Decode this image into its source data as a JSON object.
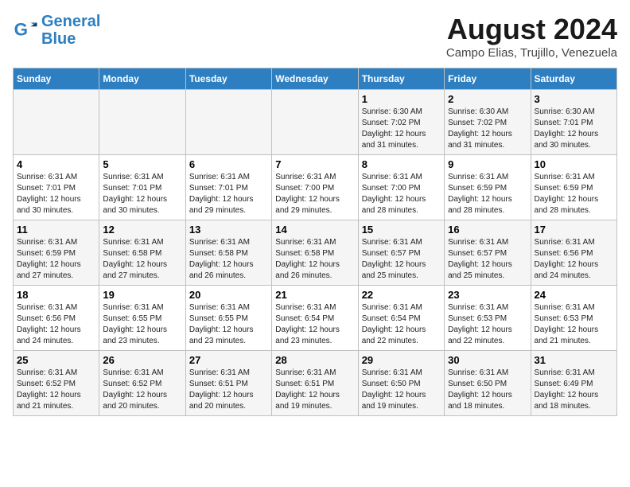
{
  "logo": {
    "line1": "General",
    "line2": "Blue"
  },
  "title": "August 2024",
  "subtitle": "Campo Elias, Trujillo, Venezuela",
  "days_of_week": [
    "Sunday",
    "Monday",
    "Tuesday",
    "Wednesday",
    "Thursday",
    "Friday",
    "Saturday"
  ],
  "weeks": [
    [
      {
        "day": "",
        "info": ""
      },
      {
        "day": "",
        "info": ""
      },
      {
        "day": "",
        "info": ""
      },
      {
        "day": "",
        "info": ""
      },
      {
        "day": "1",
        "info": "Sunrise: 6:30 AM\nSunset: 7:02 PM\nDaylight: 12 hours\nand 31 minutes."
      },
      {
        "day": "2",
        "info": "Sunrise: 6:30 AM\nSunset: 7:02 PM\nDaylight: 12 hours\nand 31 minutes."
      },
      {
        "day": "3",
        "info": "Sunrise: 6:30 AM\nSunset: 7:01 PM\nDaylight: 12 hours\nand 30 minutes."
      }
    ],
    [
      {
        "day": "4",
        "info": "Sunrise: 6:31 AM\nSunset: 7:01 PM\nDaylight: 12 hours\nand 30 minutes."
      },
      {
        "day": "5",
        "info": "Sunrise: 6:31 AM\nSunset: 7:01 PM\nDaylight: 12 hours\nand 30 minutes."
      },
      {
        "day": "6",
        "info": "Sunrise: 6:31 AM\nSunset: 7:01 PM\nDaylight: 12 hours\nand 29 minutes."
      },
      {
        "day": "7",
        "info": "Sunrise: 6:31 AM\nSunset: 7:00 PM\nDaylight: 12 hours\nand 29 minutes."
      },
      {
        "day": "8",
        "info": "Sunrise: 6:31 AM\nSunset: 7:00 PM\nDaylight: 12 hours\nand 28 minutes."
      },
      {
        "day": "9",
        "info": "Sunrise: 6:31 AM\nSunset: 6:59 PM\nDaylight: 12 hours\nand 28 minutes."
      },
      {
        "day": "10",
        "info": "Sunrise: 6:31 AM\nSunset: 6:59 PM\nDaylight: 12 hours\nand 28 minutes."
      }
    ],
    [
      {
        "day": "11",
        "info": "Sunrise: 6:31 AM\nSunset: 6:59 PM\nDaylight: 12 hours\nand 27 minutes."
      },
      {
        "day": "12",
        "info": "Sunrise: 6:31 AM\nSunset: 6:58 PM\nDaylight: 12 hours\nand 27 minutes."
      },
      {
        "day": "13",
        "info": "Sunrise: 6:31 AM\nSunset: 6:58 PM\nDaylight: 12 hours\nand 26 minutes."
      },
      {
        "day": "14",
        "info": "Sunrise: 6:31 AM\nSunset: 6:58 PM\nDaylight: 12 hours\nand 26 minutes."
      },
      {
        "day": "15",
        "info": "Sunrise: 6:31 AM\nSunset: 6:57 PM\nDaylight: 12 hours\nand 25 minutes."
      },
      {
        "day": "16",
        "info": "Sunrise: 6:31 AM\nSunset: 6:57 PM\nDaylight: 12 hours\nand 25 minutes."
      },
      {
        "day": "17",
        "info": "Sunrise: 6:31 AM\nSunset: 6:56 PM\nDaylight: 12 hours\nand 24 minutes."
      }
    ],
    [
      {
        "day": "18",
        "info": "Sunrise: 6:31 AM\nSunset: 6:56 PM\nDaylight: 12 hours\nand 24 minutes."
      },
      {
        "day": "19",
        "info": "Sunrise: 6:31 AM\nSunset: 6:55 PM\nDaylight: 12 hours\nand 23 minutes."
      },
      {
        "day": "20",
        "info": "Sunrise: 6:31 AM\nSunset: 6:55 PM\nDaylight: 12 hours\nand 23 minutes."
      },
      {
        "day": "21",
        "info": "Sunrise: 6:31 AM\nSunset: 6:54 PM\nDaylight: 12 hours\nand 23 minutes."
      },
      {
        "day": "22",
        "info": "Sunrise: 6:31 AM\nSunset: 6:54 PM\nDaylight: 12 hours\nand 22 minutes."
      },
      {
        "day": "23",
        "info": "Sunrise: 6:31 AM\nSunset: 6:53 PM\nDaylight: 12 hours\nand 22 minutes."
      },
      {
        "day": "24",
        "info": "Sunrise: 6:31 AM\nSunset: 6:53 PM\nDaylight: 12 hours\nand 21 minutes."
      }
    ],
    [
      {
        "day": "25",
        "info": "Sunrise: 6:31 AM\nSunset: 6:52 PM\nDaylight: 12 hours\nand 21 minutes."
      },
      {
        "day": "26",
        "info": "Sunrise: 6:31 AM\nSunset: 6:52 PM\nDaylight: 12 hours\nand 20 minutes."
      },
      {
        "day": "27",
        "info": "Sunrise: 6:31 AM\nSunset: 6:51 PM\nDaylight: 12 hours\nand 20 minutes."
      },
      {
        "day": "28",
        "info": "Sunrise: 6:31 AM\nSunset: 6:51 PM\nDaylight: 12 hours\nand 19 minutes."
      },
      {
        "day": "29",
        "info": "Sunrise: 6:31 AM\nSunset: 6:50 PM\nDaylight: 12 hours\nand 19 minutes."
      },
      {
        "day": "30",
        "info": "Sunrise: 6:31 AM\nSunset: 6:50 PM\nDaylight: 12 hours\nand 18 minutes."
      },
      {
        "day": "31",
        "info": "Sunrise: 6:31 AM\nSunset: 6:49 PM\nDaylight: 12 hours\nand 18 minutes."
      }
    ]
  ]
}
